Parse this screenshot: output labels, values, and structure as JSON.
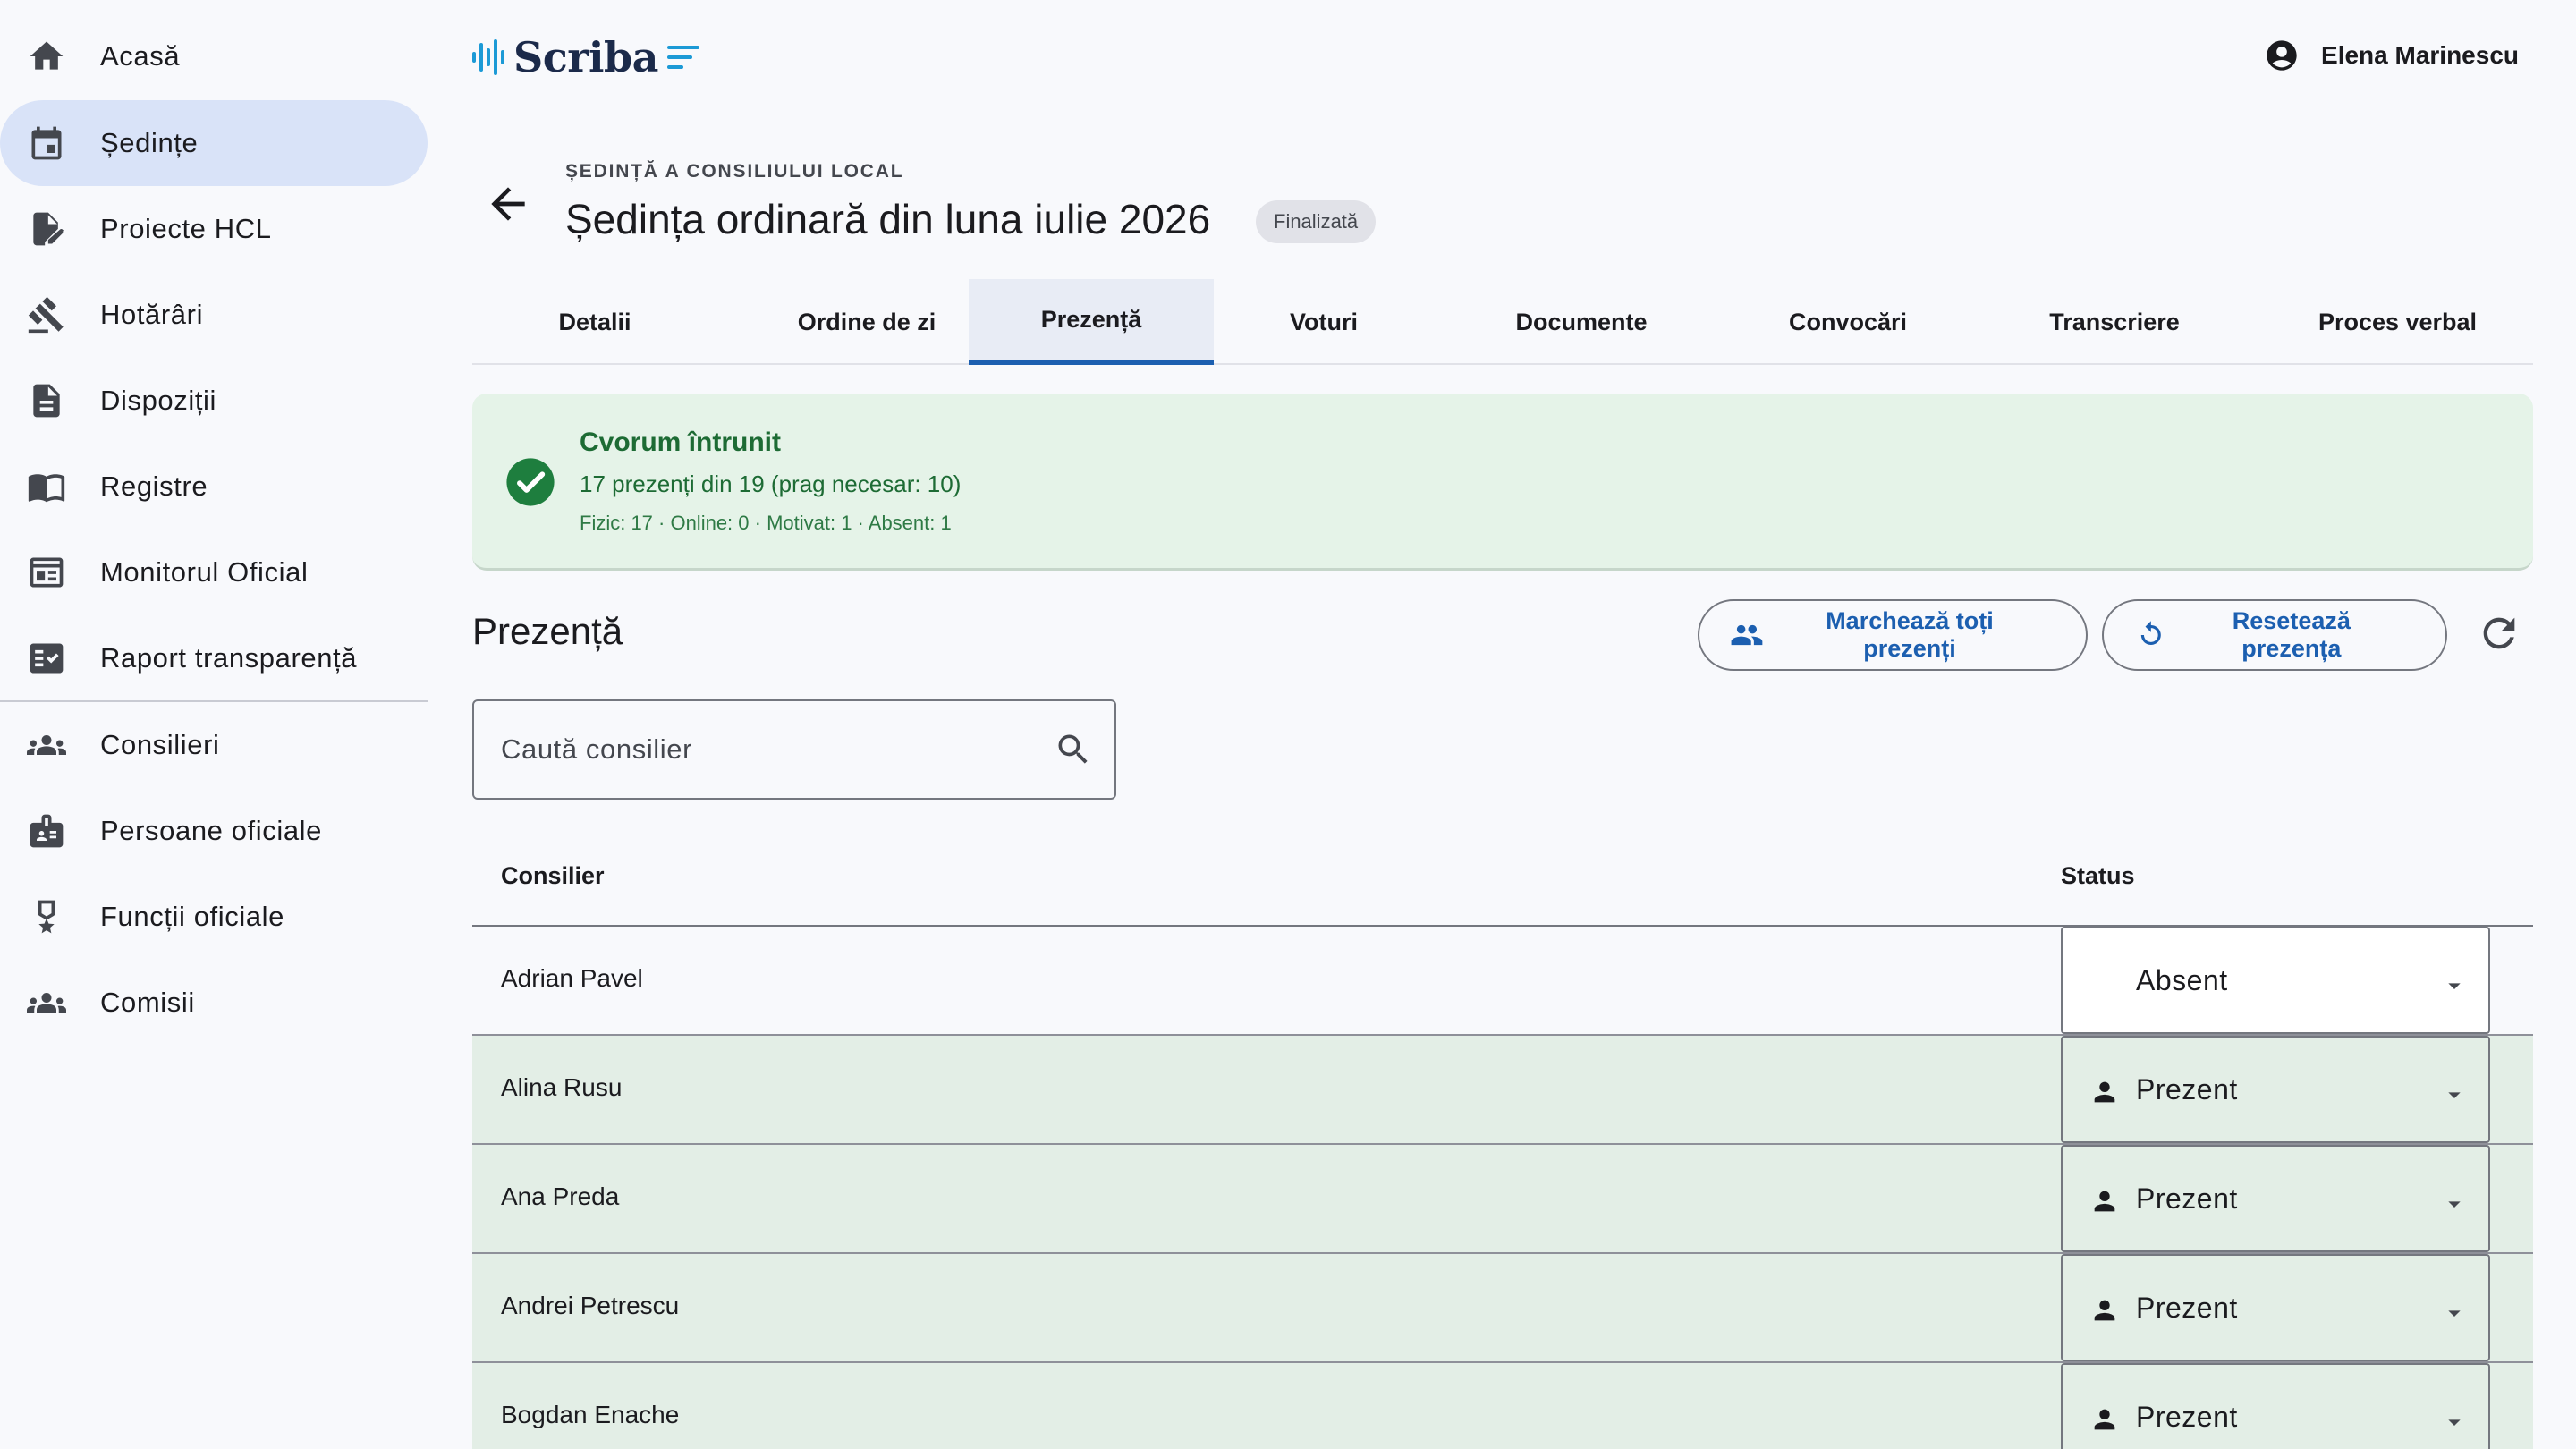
{
  "sidebar": {
    "items": [
      {
        "label": "Acasă",
        "icon": "home-icon"
      },
      {
        "label": "Ședințe",
        "icon": "calendar-icon",
        "active": true
      },
      {
        "label": "Proiecte HCL",
        "icon": "document-edit-icon"
      },
      {
        "label": "Hotărâri",
        "icon": "gavel-icon"
      },
      {
        "label": "Dispoziții",
        "icon": "description-icon"
      },
      {
        "label": "Registre",
        "icon": "book-icon"
      },
      {
        "label": "Monitorul Oficial",
        "icon": "newspaper-icon"
      },
      {
        "label": "Raport transparență",
        "icon": "fact-check-icon"
      },
      {
        "label": "Consilieri",
        "icon": "groups-icon"
      },
      {
        "label": "Persoane oficiale",
        "icon": "badge-icon"
      },
      {
        "label": "Funcții oficiale",
        "icon": "award-icon"
      },
      {
        "label": "Comisii",
        "icon": "groups-icon"
      }
    ]
  },
  "header": {
    "logo_text": "Scriba",
    "user_name": "Elena Marinescu",
    "brand_color": "#1c9ad6"
  },
  "page": {
    "overline": "ȘEDINȚĂ A CONSILIULUI LOCAL",
    "title": "Ședința ordinară din luna iulie 2026",
    "status_chip": "Finalizată"
  },
  "tabs": [
    {
      "label": "Detalii"
    },
    {
      "label": "Ordine de zi"
    },
    {
      "label": "Prezență",
      "active": true
    },
    {
      "label": "Voturi"
    },
    {
      "label": "Documente"
    },
    {
      "label": "Convocări"
    },
    {
      "label": "Transcriere"
    },
    {
      "label": "Proces verbal"
    }
  ],
  "quorum": {
    "title": "Cvorum întrunit",
    "summary": "17 prezenți din 19 (prag necesar: 10)",
    "details": "Fizic: 17 · Online: 0 · Motivat: 1 · Absent: 1",
    "color": "#1d6b34"
  },
  "attendance": {
    "section_title": "Prezență",
    "mark_all_label": "Marchează toți prezenți",
    "reset_label": "Resetează prezența",
    "search_placeholder": "Caută consilier",
    "columns": {
      "councillor": "Consilier",
      "status": "Status"
    },
    "rows": [
      {
        "name": "Adrian Pavel",
        "status": "Absent"
      },
      {
        "name": "Alina Rusu",
        "status": "Prezent"
      },
      {
        "name": "Ana Preda",
        "status": "Prezent"
      },
      {
        "name": "Andrei Petrescu",
        "status": "Prezent"
      },
      {
        "name": "Bogdan Enache",
        "status": "Prezent"
      }
    ]
  }
}
